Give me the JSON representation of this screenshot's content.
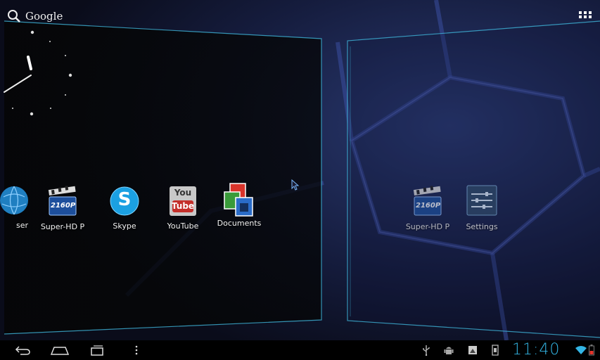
{
  "search": {
    "label": "Google"
  },
  "apps": [
    {
      "name": "browser",
      "label": "ser"
    },
    {
      "name": "superhd",
      "label": "Super-HD P",
      "badge": "2160P"
    },
    {
      "name": "skype",
      "label": "Skype",
      "glyph": "S"
    },
    {
      "name": "youtube",
      "label": "YouTube",
      "top_text": "You",
      "bottom_text": "Tube"
    },
    {
      "name": "documents",
      "label": "Documents"
    }
  ],
  "apps_right": [
    {
      "name": "superhd",
      "label": "Super-HD P",
      "badge": "2160P"
    },
    {
      "name": "settings",
      "label": "Settings"
    }
  ],
  "status": {
    "time": "11:40"
  },
  "colors": {
    "accent": "#33b5e5",
    "panel_edge": "#3fb4d8"
  }
}
